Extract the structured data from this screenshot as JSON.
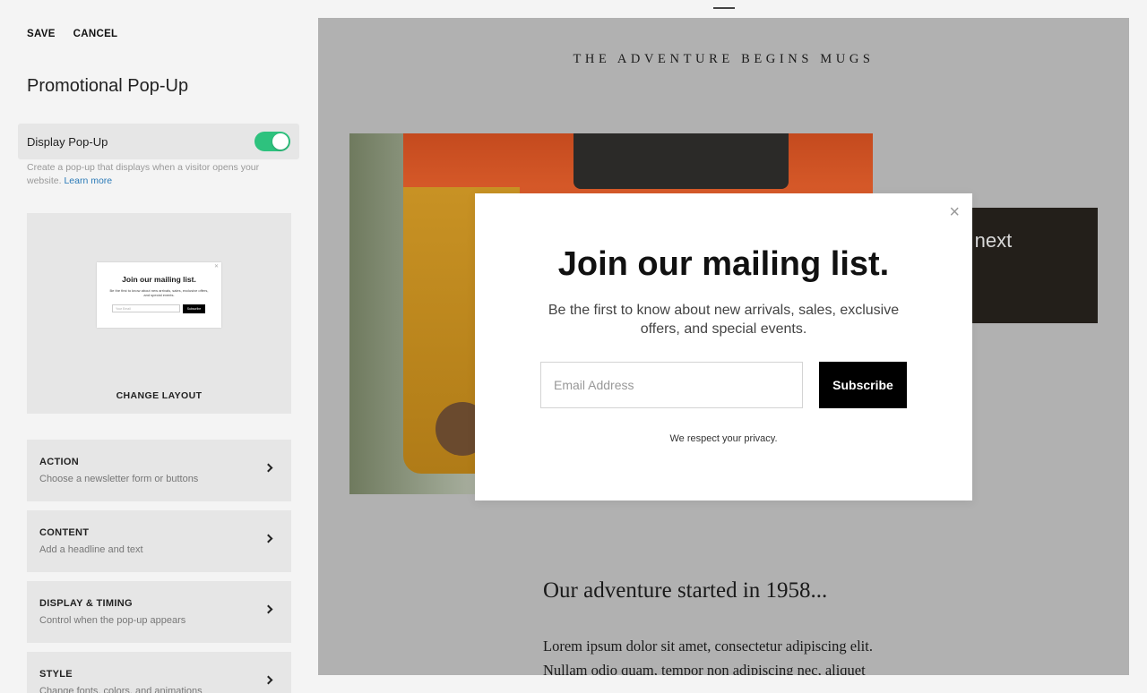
{
  "topbar": {
    "save": "SAVE",
    "cancel": "CANCEL"
  },
  "panel": {
    "title": "Promotional Pop-Up",
    "toggle": {
      "label": "Display Pop-Up",
      "enabled": true,
      "color": "#2ec27e"
    },
    "help_text": "Create a pop-up that displays when a visitor opens your website.",
    "help_link": "Learn more",
    "layout": {
      "thumb_headline": "Join our mailing list.",
      "thumb_body": "Be the first to know about new arrivals, sales, exclusive offers, and special events.",
      "thumb_placeholder": "Your Email",
      "thumb_button": "Subscribe",
      "change_label": "CHANGE LAYOUT"
    },
    "menu": [
      {
        "title": "ACTION",
        "subtitle": "Choose a newsletter form or buttons"
      },
      {
        "title": "CONTENT",
        "subtitle": "Add a headline and text"
      },
      {
        "title": "DISPLAY & TIMING",
        "subtitle": "Control when the pop-up appears"
      },
      {
        "title": "STYLE",
        "subtitle": "Change fonts, colors, and animations"
      }
    ]
  },
  "preview": {
    "site_title": "THE ADVENTURE BEGINS MUGS",
    "card_text": "ur next",
    "story_heading": "Our adventure started in 1958...",
    "story_body": "Lorem ipsum dolor sit amet, consectetur adipiscing elit. Nullam odio quam, tempor non adipiscing nec, aliquet"
  },
  "popup": {
    "close_icon": "×",
    "headline": "Join our mailing list.",
    "body": "Be the first to know about new arrivals, sales, exclusive offers, and special events.",
    "email_placeholder": "Email Address",
    "button": "Subscribe",
    "privacy": "We respect your privacy."
  }
}
